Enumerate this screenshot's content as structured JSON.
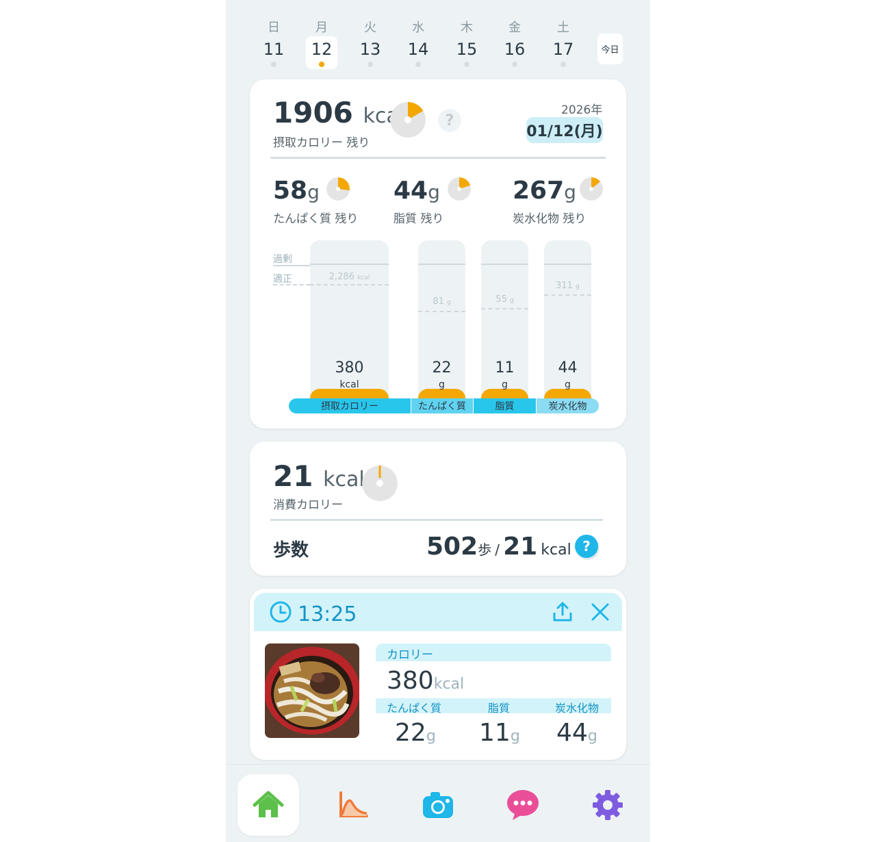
{
  "week": {
    "days": [
      {
        "dow": "日",
        "date": "11"
      },
      {
        "dow": "月",
        "date": "12"
      },
      {
        "dow": "火",
        "date": "13"
      },
      {
        "dow": "水",
        "date": "14"
      },
      {
        "dow": "木",
        "date": "15"
      },
      {
        "dow": "金",
        "date": "16"
      },
      {
        "dow": "土",
        "date": "17"
      }
    ],
    "selected_date": "12",
    "today_label": "今日"
  },
  "intake": {
    "remaining_value": "1906",
    "unit": "kcal",
    "label": "摂取カロリー 残り",
    "year": "2026年",
    "date": "01/12(月)",
    "help": "?",
    "pie_fraction": 0.166,
    "macros": [
      {
        "value": "58",
        "unit": "g",
        "label": "たんぱく質 残り",
        "fraction": 0.27
      },
      {
        "value": "44",
        "unit": "g",
        "label": "脂質 残り",
        "fraction": 0.2
      },
      {
        "value": "267",
        "unit": "g",
        "label": "炭水化物 残り",
        "fraction": 0.14
      }
    ]
  },
  "chart_data": {
    "type": "bar",
    "reference_lines": [
      "過剰",
      "適正"
    ],
    "categories": [
      "摂取カロリー",
      "たんぱく質",
      "脂質",
      "炭水化物"
    ],
    "values": [
      380,
      22,
      11,
      44
    ],
    "units": [
      "kcal",
      "g",
      "g",
      "g"
    ],
    "targets": [
      "2,286",
      "81",
      "55",
      "311"
    ],
    "target_units": [
      "kcal",
      "g",
      "g",
      "g"
    ],
    "colors": {
      "fill": "#f3a700",
      "category_bar": "#29c6ec",
      "category_bar_light": "#8bdcf3"
    }
  },
  "burned": {
    "value": "21",
    "unit": "kcal",
    "label": "消費カロリー",
    "steps_label": "歩数",
    "steps_value": "502",
    "steps_unit": "歩",
    "separator": "/",
    "steps_kcal": "21",
    "steps_kcal_unit": "kcal",
    "help": "?"
  },
  "meal": {
    "time": "13:25",
    "calorie_label": "カロリー",
    "calorie_value": "380",
    "calorie_unit": "kcal",
    "macro_labels": [
      "たんぱく質",
      "脂質",
      "炭水化物"
    ],
    "macro_values": [
      "22",
      "11",
      "44"
    ],
    "macro_unit": "g"
  },
  "nav": {
    "items": [
      "home-icon",
      "chart-icon",
      "camera-icon",
      "chat-icon",
      "gear-icon"
    ],
    "active": "home-icon",
    "colors": {
      "home": "#5cc04a",
      "chart": "#f07a3a",
      "camera": "#1fb6e8",
      "chat": "#ea4e98",
      "gear": "#7e5ce0"
    }
  }
}
